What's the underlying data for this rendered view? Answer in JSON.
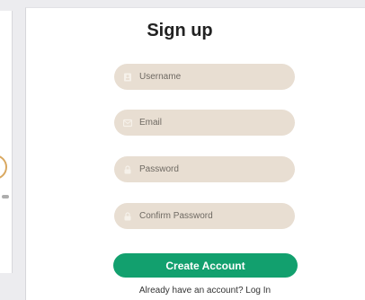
{
  "colors": {
    "field_bg": "#e8ded2",
    "accent": "#12a06e",
    "icon": "#f6f1ea"
  },
  "form": {
    "title": "Sign up",
    "fields": [
      {
        "icon": "user-icon",
        "placeholder": "Username"
      },
      {
        "icon": "mail-icon",
        "placeholder": "Email"
      },
      {
        "icon": "lock-icon",
        "placeholder": "Password"
      },
      {
        "icon": "lock-icon",
        "placeholder": "Confirm Password"
      }
    ],
    "submit_label": "Create Account",
    "login_prompt": "Already have an account? ",
    "login_link": "Log In"
  }
}
